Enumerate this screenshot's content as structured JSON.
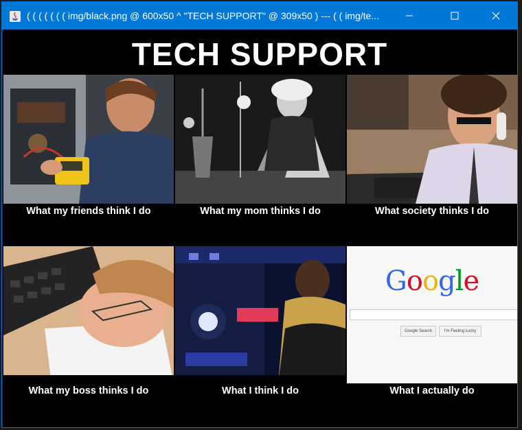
{
  "window": {
    "title": "( ( ( ( ( ( ( img/black.png @ 600x50 ^ \"TECH SUPPORT\" @ 309x50 ) --- ( ( img/te...",
    "icon": "java-app-icon",
    "controls": {
      "minimize": "minimize-icon",
      "maximize": "maximize-icon",
      "close": "close-icon"
    }
  },
  "meme": {
    "heading": "TECH SUPPORT",
    "panels": [
      {
        "caption": "What my friends think I do",
        "image": "technician-repairing-computer-photo"
      },
      {
        "caption": "What my mom thinks I do",
        "image": "mad-scientist-laboratory-photo"
      },
      {
        "caption": "What society thinks I do",
        "image": "it-worker-on-phone-photo"
      },
      {
        "caption": "What my boss thinks I do",
        "image": "man-asleep-on-keyboard-photo"
      },
      {
        "caption": "What I think I do",
        "image": "starship-engine-room-photo"
      },
      {
        "caption": "What I actually do",
        "image": "google-search-homepage-screenshot"
      }
    ],
    "google": {
      "logo": "Google",
      "colors": [
        "#3369e8",
        "#d50f25",
        "#eeb211",
        "#3369e8",
        "#009925",
        "#d50f25"
      ],
      "buttons": [
        "Google Search",
        "I'm Feeling Lucky"
      ]
    }
  },
  "colors": {
    "titlebar": "#0078d7",
    "background": "#000000",
    "text": "#ffffff"
  }
}
